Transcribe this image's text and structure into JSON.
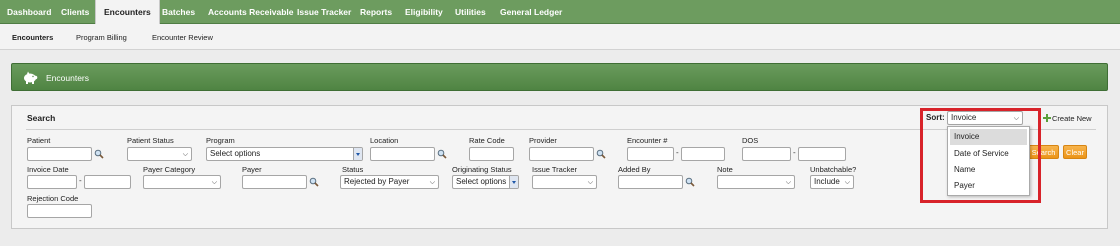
{
  "nav": {
    "tabs": [
      "Dashboard",
      "Clients",
      "Encounters",
      "Batches",
      "Accounts Receivable",
      "Issue Tracker",
      "Reports",
      "Eligibility",
      "Utilities",
      "General Ledger"
    ],
    "active": "Encounters"
  },
  "subnav": {
    "items": [
      "Encounters",
      "Program Billing",
      "Encounter Review"
    ],
    "active": "Encounters"
  },
  "panel": {
    "title": "Encounters"
  },
  "search": {
    "title": "Search",
    "labels": {
      "patient": "Patient",
      "patient_status": "Patient Status",
      "program": "Program",
      "location": "Location",
      "rate_code": "Rate Code",
      "provider": "Provider",
      "encounter_no": "Encounter #",
      "dos": "DOS",
      "invoice_date": "Invoice Date",
      "payer_category": "Payer Category",
      "payer": "Payer",
      "status": "Status",
      "originating_status": "Originating Status",
      "issue_tracker": "Issue Tracker",
      "added_by": "Added By",
      "note": "Note",
      "unbatchable": "Unbatchable?",
      "rejection_code": "Rejection Code"
    },
    "values": {
      "program": "Select options",
      "status": "Rejected by Payer",
      "originating_status": "Select options",
      "unbatchable": "Include"
    },
    "sort": {
      "label": "Sort:",
      "selected": "Invoice",
      "options": [
        "Invoice",
        "Date of Service",
        "Name",
        "Payer"
      ],
      "highlighted": "Invoice"
    },
    "create_new": "Create New",
    "search_button": "Search",
    "clear_button": "Clear"
  },
  "colors": {
    "nav_green": "#6d9c5f",
    "panel_green": "#4f8443",
    "button_orange": "#ec9418",
    "highlight_red": "#d8232a"
  }
}
